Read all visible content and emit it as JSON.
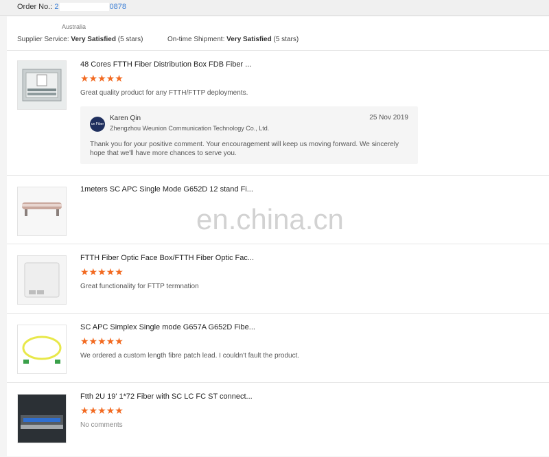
{
  "order": {
    "label": "Order No.:",
    "prefix": "2",
    "suffix": "0878"
  },
  "buyer": {
    "country": "Australia"
  },
  "ratings": {
    "supplier_label": "Supplier Service:",
    "supplier_value": "Very Satisfied",
    "supplier_stars": "(5 stars)",
    "shipment_label": "On-time Shipment:",
    "shipment_value": "Very Satisfied",
    "shipment_stars": "(5 stars)"
  },
  "accent_color": "#f26a21",
  "link_color": "#3b7fd6",
  "reviews": [
    {
      "title": "48 Cores FTTH Fiber Distribution Box FDB Fiber ...",
      "stars": "★★★★★",
      "rating": 5,
      "comment": "Great quality product for any FTTH/FTTP deployments.",
      "image_icon": "distribution-box-image",
      "reply": {
        "avatar_text": "un Fiber",
        "name": "Karen Qin",
        "company": "Zhengzhou Weunion Communication Technology Co., Ltd.",
        "date": "25 Nov 2019",
        "text": "Thank you for your positive comment. Your encouragement will keep us moving forward. We sincerely hope that we'll have more chances to serve you."
      }
    },
    {
      "title": "1meters SC APC Single Mode G652D 12 stand Fi...",
      "image_icon": "fiber-cable-image"
    },
    {
      "title": "FTTH Fiber Optic Face Box/FTTH Fiber Optic Fac...",
      "stars": "★★★★★",
      "rating": 5,
      "comment": "Great functionality for FTTP termnation",
      "image_icon": "face-box-image"
    },
    {
      "title": "SC APC Simplex Single mode G657A G652D Fibe...",
      "stars": "★★★★★",
      "rating": 5,
      "comment": "We ordered a custom length fibre patch lead. I couldn't fault the product.",
      "image_icon": "patch-cord-image"
    },
    {
      "title": "Ftth 2U 19' 1*72 Fiber with SC LC FC ST connect...",
      "stars": "★★★★★",
      "rating": 5,
      "comment": "No comments",
      "image_icon": "rack-panel-image"
    }
  ],
  "watermark": "en.china.cn"
}
